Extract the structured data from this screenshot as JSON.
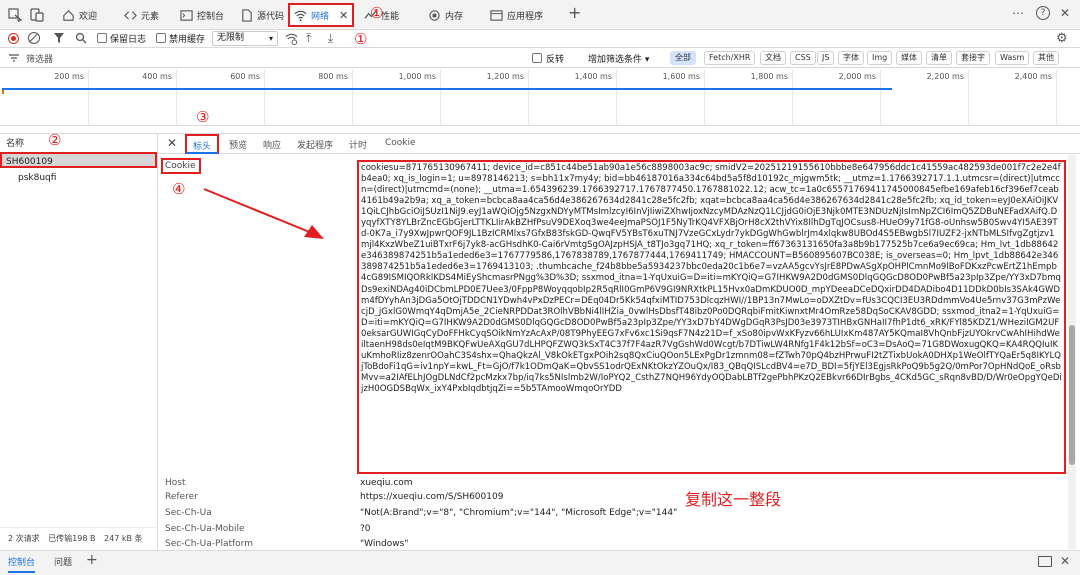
{
  "tabs": [
    {
      "label": "欢迎",
      "icon": "home-icon"
    },
    {
      "label": "元素",
      "icon": "elements-icon"
    },
    {
      "label": "控制台",
      "icon": "console-icon"
    },
    {
      "label": "源代码",
      "icon": "sources-icon"
    },
    {
      "label": "网络",
      "icon": "wifi-icon"
    },
    {
      "label": "性能",
      "icon": "performance-icon"
    },
    {
      "label": "内存",
      "icon": "memory-icon"
    },
    {
      "label": "应用程序",
      "icon": "application-icon"
    }
  ],
  "markers": {
    "m1": "①",
    "m2": "②",
    "m3": "③",
    "m4": "④"
  },
  "toolbar": {
    "preserve_log": "保留日志",
    "disable_cache": "禁用缓存",
    "throttle": "无限制"
  },
  "filter": {
    "placeholder": "筛选器",
    "invert": "反转",
    "more_filters": "增加筛选条件",
    "types": [
      "全部",
      "Fetch/XHR",
      "文档",
      "CSS",
      "JS",
      "字体",
      "Img",
      "媒体",
      "清单",
      "套接字",
      "Wasm",
      "其他"
    ]
  },
  "timeline": {
    "ticks": [
      "200 ms",
      "400 ms",
      "600 ms",
      "800 ms",
      "1,000 ms",
      "1,200 ms",
      "1,400 ms",
      "1,600 ms",
      "1,800 ms",
      "2,000 ms",
      "2,200 ms",
      "2,400 ms"
    ]
  },
  "list": {
    "header": "名称",
    "rows": [
      "SH600109",
      "psk8uqfi"
    ]
  },
  "detail": {
    "tabs": [
      "标头",
      "预览",
      "响应",
      "发起程序",
      "计时",
      "Cookie"
    ],
    "cookie_key": "Cookie",
    "cookie_value": "cookiesu=871765130967411; device_id=c851c44be51ab90a1e56c8898003ac9c; smidV2=20251219155610bbbe8e647956ddc1c41559ac482593de001f7c2e2e4fb4ea0; xq_is_login=1; u=8978146213; s=bh11x7my4y; bid=bb46187016a334c64bd5a5f8d10192c_mjgwm5tk; __utmz=1.1766392717.1.1.utmcsr=(direct)|utmccn=(direct)|utmcmd=(none); __utma=1.654396239.1766392717.1767877450.1767881022.12; acw_tc=1a0c65571769411745000845efbe169afeb16cf396ef7ceab4161b49a2b9a; xq_a_token=bcbca8aa4ca56d4e386267634d2841c28e5fc2fb; xqat=bcbca8aa4ca56d4e386267634d2841c28e5fc2fb; xq_id_token=eyJ0eXAiOiJKV1QiLCJhbGciOiJSUzI1NiJ9.eyJ1aWQiOjg5NzgxNDYyMTMsImlzcyI6InVjIiwiZXhwIjoxNzcyMDAzNzQ1LCJjdG0iOjE3Njk0MTE3NDUzNjIsImNpZCI6ImQ5ZDBuNEFadXAifQ.DyqyfXTY8YLBrZncEGbGjerLTTKLIirAkBZHfPsuV9DEXoq3we4eeJmaPSOJ1F5NyTrKQ4VFXBjOrH8cX2thVYix8IlhDgTqJOCsus8-HUeO9y71fG8-oUnhsw5B0Swv4YI5AE39Td-0K7a_i7y9XwJpwrQOF9JL1BzICRMlxs7GfxB83fskGD-QwqFV5YBsT6xuTNJ7VzeGCxLydr7ykDGgWhGwblrJm4xlqkw8UBOd4S5EBwgbSl7IUZF2-jxNTbMLSIfvgZgtjzv1mjl4KxzWbeZ1uiBTxrF6j7yk8-acGHsdhK0-Cai6rVmtgSgOAJzpHSJA_t8TJo3gq71HQ; xq_r_token=ff67363131650fa3a8b9b177525b7ce6a9ec69ca; Hm_lvt_1db88642e346389874251b5a1eded6e3=1767779586,1767838789,1767877444,1769411749; HMACCOUNT=B560895607BC038E; is_overseas=0; Hm_lpvt_1db88642e346389874251b5a1eded6e3=1769413103; .thumbcache_f24b8bbe5a5934237bbc0eda20c1b6e7=vzAA5gcvYsJrE8PDwASgXpOHPlCmnMo9lBoFDKxzPcwErtZ1hEmpb4cG89ISMIQORklKDS4MiEyShcmasrPNgg%3D%3D; ssxmod_itna=1-YqUxuiG=D=iti=mKYQiQ=G7IHKW9A2D0dGMS0DlqGQGcD8OD0PwBf5a23pIp3Zpe/YY3xD7bmqDs9exiNDAg40iDCbmLPD0E7Uee3/0FppP8WoyqqobIp2R5qRlI0GmP6V9GI9NRXtkPL15Hvx0aDmKDUO0D_mpYDeeaDCeDQxirDD4DADibo4D11DDkD0bIs3SAk4GWDm4fDYyhAn3jDGa5OtOjTDDCN1YDwh4vPxDzPECr=DEq04Dr5Kk54qfxiMTID753DlcqzHWI//1BP13n7MwLo=oDXZtDv=fUs3CQCI3EU3RDdmmVo4Ue5rnv37G3mPzWecjD_jGxlG0WmqY4qDmjA5e_2CieNRPDDat3ROlhVBbNi4lIHZia_0vwlHsDbsfT48ibz0Po0DQRqbiFmitKiwnxtMr4OmRze58DqSoCKAV8GDD; ssxmod_itna2=1-YqUxuiG=D=iti=mKYQiQ=G7IHKW9A2D0dGMS0DlqGQGcD8OD0PwBf5a23pIp3Zpe/YY3xD7bY4DWgDGqR3PsJD03e3973TIHBxGNHaII7fhP1dt6_xRK/FYl85KDZ1/WHeziIGM2UF0eksarGUWIGqCyDoFFHkCyqSOikNmYzAcAxP/08T9PhyEEG7xFv6xc1Si9qsF7N4z21D=f_xSo80ipvWxKFyzv66hLUIxKm487AY5KQmaI8VhQnbFjzUYOkrvCwAhIHihdWeiltaenH98ds0eIqtM9BKQFwUeAXqGU7dLHPQFZWQ3kSxT4C37f7F4azR7VgGshWd0Wcgt/b7DTiwLW4RNfg1F4k12bSf=oC3=DsAoQ=71G8DWoxugQKQ=KA4RQQIuIKuKmhoRIiz8zenrOOahC3S4shx=QhaQkzAl_V8kOkETgxPOih2sq8QxCiuQOon5LExPgDr1zmnm08=fZTwh70pQ4bzHPrwuFI2tZTixbUokA0DHXp1WeOlfTYQaEr5q8IKYLQjToBdoFi1qG=iv1npY=kwL_Ft=GjO/f7k1ODmQaK=QbvSS1odrQExNKtOkzYZOuQx/I83_QBqQISLcdBV4=e7D_BDI=5fjYEl3EgjsRkPoQ9b5g2Q/0mPor7OpHNdQoE_oRsbMvv=a2IAfELhJOgDLNdCf2pcMzkx7bp/iq7ks5NIslmb2W/IoPYQ2_CsthZ7NQH96YdyOQDabLBTf2gePbhPKzQ2EBkvr66DIrBgbs_4CKd5GC_sRqn8vBD/D/Wr0eOpgYQeDijzH0OGDSBqWx_ixY4PxbIqdbtjqZi==5b5TAmooWmqoOrYDD",
    "headers": [
      {
        "key": "Host",
        "value": "xueqiu.com"
      },
      {
        "key": "Referer",
        "value": "https://xueqiu.com/S/SH600109"
      },
      {
        "key": "Sec-Ch-Ua",
        "value": "\"Not(A:Brand\";v=\"8\", \"Chromium\";v=\"144\", \"Microsoft Edge\";v=\"144\""
      },
      {
        "key": "Sec-Ch-Ua-Mobile",
        "value": "?0"
      },
      {
        "key": "Sec-Ch-Ua-Platform",
        "value": "\"Windows\""
      }
    ]
  },
  "annotation": "复制这一整段",
  "status": {
    "requests": "2 次请求",
    "transferred": "已传输198 B",
    "resources": "247 kB 条"
  },
  "drawer": {
    "console": "控制台",
    "issues": "问题"
  },
  "colors": {
    "accent": "#1a73e8",
    "highlight": "#e02020"
  }
}
